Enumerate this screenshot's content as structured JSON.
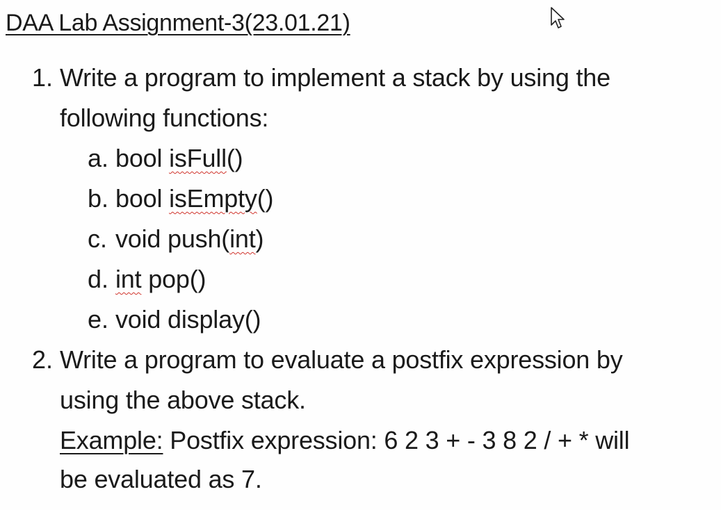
{
  "title": "DAA Lab Assignment-3(23.01.21)",
  "items": [
    {
      "number": "1.",
      "line1": "Write a program to implement a stack by using the",
      "line2": "following functions:",
      "subitems": [
        {
          "letter": "a.",
          "pre": "bool ",
          "squiggle": "isFull",
          "post": "()"
        },
        {
          "letter": "b.",
          "pre": "bool ",
          "squiggle": "isEmpty",
          "post": "()"
        },
        {
          "letter": "c.",
          "pre": "void push(",
          "squiggle": "int",
          "post": ")"
        },
        {
          "letter": "d.",
          "pre": "",
          "squiggle": "int",
          "post": " pop()"
        },
        {
          "letter": "e.",
          "pre": "void display()",
          "squiggle": "",
          "post": ""
        }
      ]
    },
    {
      "number": "2.",
      "line1": "Write a program to evaluate a postfix expression by",
      "line2": "using the above stack.",
      "example_label": "Example:",
      "example_text": " Postfix expression: 6 2 3 + - 3 8 2 / + * will",
      "example_line2": "be evaluated as 7."
    }
  ],
  "cursor_icon": "mouse-pointer-icon"
}
